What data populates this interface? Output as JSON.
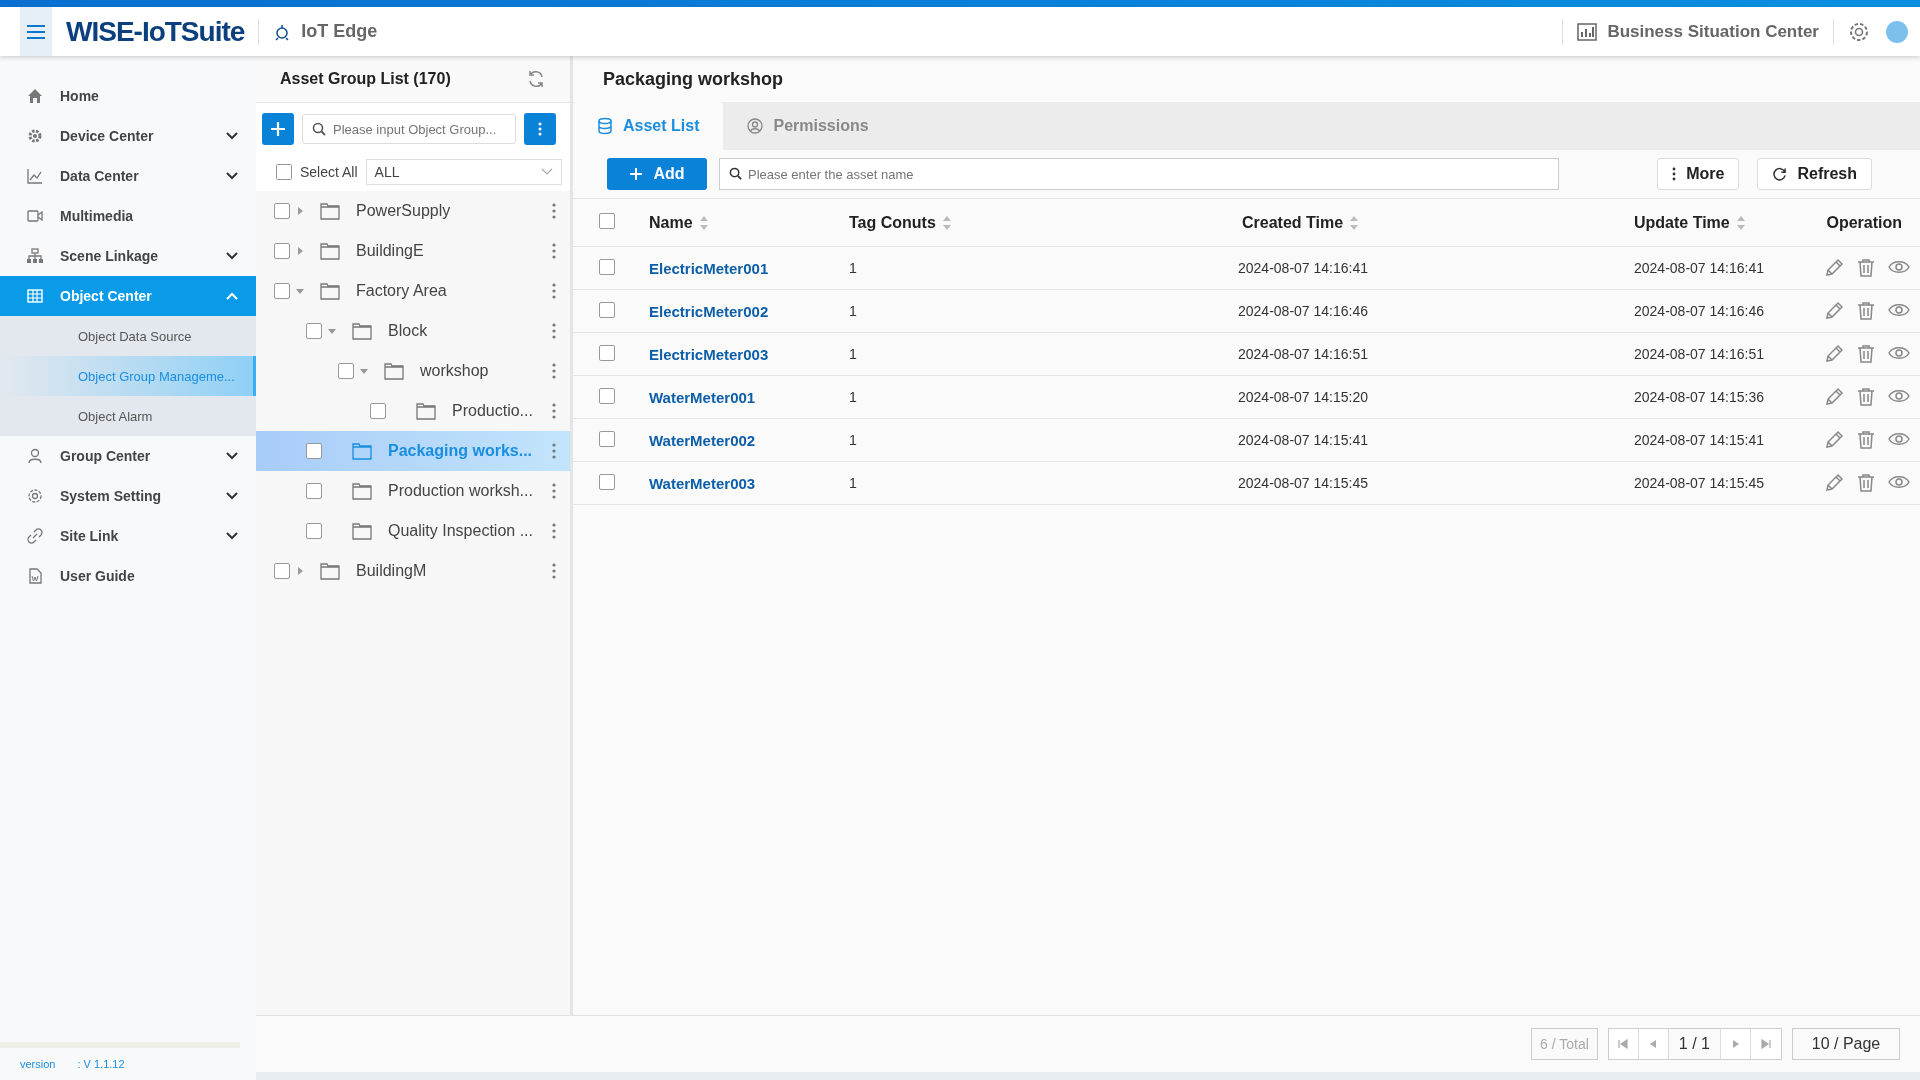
{
  "header": {
    "brand": "WISE-IoTSuite",
    "app": "IoT Edge",
    "center": "Business Situation Center"
  },
  "sidebar": {
    "items": [
      {
        "label": "Home",
        "expandable": false,
        "selected": false
      },
      {
        "label": "Device Center",
        "expandable": true,
        "expanded": false,
        "selected": false
      },
      {
        "label": "Data Center",
        "expandable": true,
        "expanded": false,
        "selected": false
      },
      {
        "label": "Multimedia",
        "expandable": false,
        "selected": false
      },
      {
        "label": "Scene Linkage",
        "expandable": true,
        "expanded": false,
        "selected": false
      },
      {
        "label": "Object Center",
        "expandable": true,
        "expanded": true,
        "selected": true,
        "children": [
          {
            "label": "Object Data Source",
            "selected": false
          },
          {
            "label": "Object Group Manageme...",
            "selected": true
          },
          {
            "label": "Object Alarm",
            "selected": false
          }
        ]
      },
      {
        "label": "Group Center",
        "expandable": true,
        "expanded": false,
        "selected": false
      },
      {
        "label": "System Setting",
        "expandable": true,
        "expanded": false,
        "selected": false
      },
      {
        "label": "Site Link",
        "expandable": true,
        "expanded": false,
        "selected": false
      },
      {
        "label": "User Guide",
        "expandable": false,
        "selected": false
      }
    ],
    "version_label": "version",
    "version": ": V 1.1.12"
  },
  "tree": {
    "title": "Asset Group List (170)",
    "search_placeholder": "Please input Object Group...",
    "select_all": "Select All",
    "select_all_checked": false,
    "filter": "ALL",
    "nodes": [
      {
        "label": "PowerSupply",
        "checked": false,
        "expanded": false,
        "selected": false,
        "has_children": true
      },
      {
        "label": "BuildingE",
        "checked": false,
        "expanded": false,
        "selected": false,
        "has_children": true
      },
      {
        "label": "Factory Area",
        "checked": false,
        "expanded": true,
        "selected": false,
        "has_children": true,
        "children": [
          {
            "label": "Block",
            "checked": false,
            "expanded": true,
            "selected": false,
            "has_children": true,
            "children": [
              {
                "label": "workshop",
                "checked": false,
                "expanded": true,
                "selected": false,
                "has_children": true,
                "children": [
                  {
                    "label": "Productio...",
                    "checked": false,
                    "expanded": false,
                    "selected": false,
                    "has_children": false
                  }
                ]
              }
            ]
          },
          {
            "label": "Packaging works...",
            "checked": false,
            "expanded": false,
            "selected": true,
            "has_children": false
          },
          {
            "label": "Production worksh...",
            "checked": false,
            "expanded": false,
            "selected": false,
            "has_children": false
          },
          {
            "label": "Quality Inspection ...",
            "checked": false,
            "expanded": false,
            "selected": false,
            "has_children": false
          }
        ]
      },
      {
        "label": "BuildingM",
        "checked": false,
        "expanded": false,
        "selected": false,
        "has_children": true
      }
    ]
  },
  "main": {
    "title": "Packaging workshop",
    "tabs": [
      {
        "label": "Asset List",
        "selected": true
      },
      {
        "label": "Permissions",
        "selected": false
      }
    ],
    "add": "Add",
    "search_placeholder": "Please enter the asset name",
    "more": "More",
    "refresh": "Refresh",
    "table": {
      "all_checked": false,
      "columns": [
        {
          "label": "Name",
          "sortable": true
        },
        {
          "label": "Tag Conuts",
          "sortable": true
        },
        {
          "label": "Created Time",
          "sortable": true
        },
        {
          "label": "Update Time",
          "sortable": true
        },
        {
          "label": "Operation",
          "sortable": false
        }
      ],
      "rows": [
        {
          "checked": false,
          "name": "ElectricMeter001",
          "tags": "1",
          "created": "2024-08-07 14:16:41",
          "updated": "2024-08-07 14:16:41"
        },
        {
          "checked": false,
          "name": "ElectricMeter002",
          "tags": "1",
          "created": "2024-08-07 14:16:46",
          "updated": "2024-08-07 14:16:46"
        },
        {
          "checked": false,
          "name": "ElectricMeter003",
          "tags": "1",
          "created": "2024-08-07 14:16:51",
          "updated": "2024-08-07 14:16:51"
        },
        {
          "checked": false,
          "name": "WaterMeter001",
          "tags": "1",
          "created": "2024-08-07 14:15:20",
          "updated": "2024-08-07 14:15:36"
        },
        {
          "checked": false,
          "name": "WaterMeter002",
          "tags": "1",
          "created": "2024-08-07 14:15:41",
          "updated": "2024-08-07 14:15:41"
        },
        {
          "checked": false,
          "name": "WaterMeter003",
          "tags": "1",
          "created": "2024-08-07 14:15:45",
          "updated": "2024-08-07 14:15:45"
        }
      ]
    },
    "pagination": {
      "total": "6 / Total",
      "page": "1 / 1",
      "page_size": "10 / Page"
    }
  }
}
